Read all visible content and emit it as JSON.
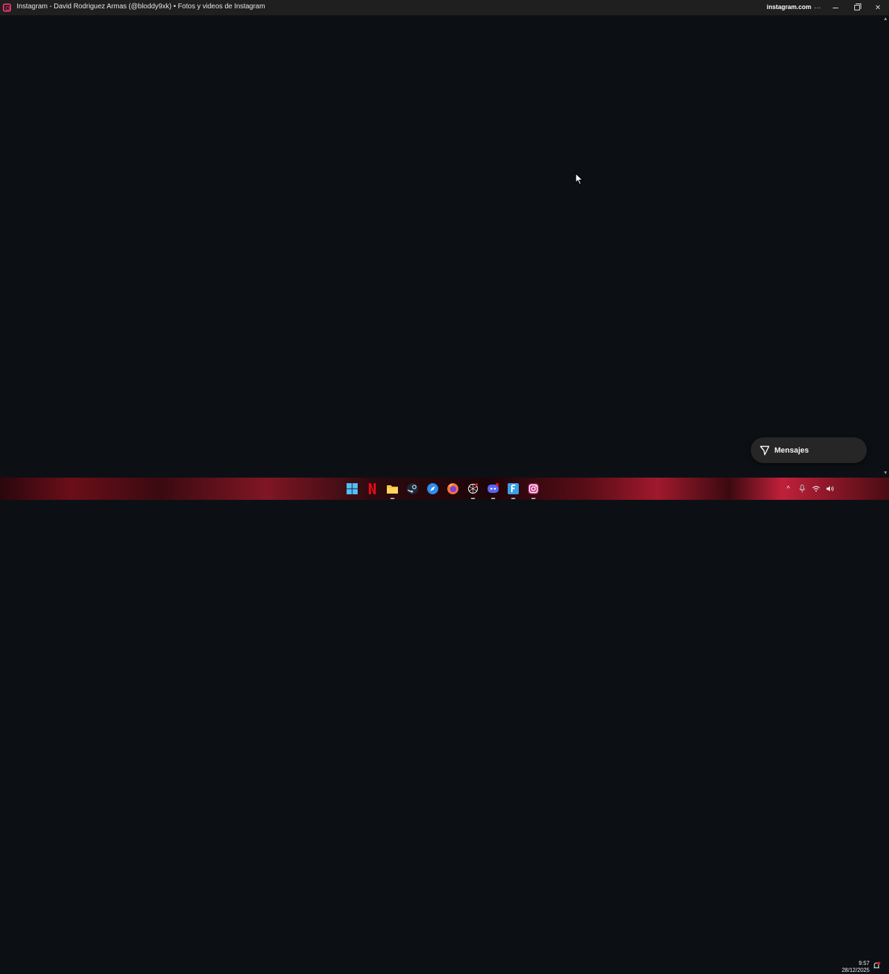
{
  "window": {
    "title": "Instagram - David Rodriguez Armas (@bloddy9xk) • Fotos y videos de Instagram",
    "domain": "instagram.com",
    "more_label": "···",
    "close_label": "✕"
  },
  "messages_button": {
    "label": "Mensajes"
  },
  "taskbar": {
    "apps": [
      "windows-start",
      "netflix",
      "file-explorer",
      "steam",
      "browser-blue",
      "firefox",
      "openai",
      "discord",
      "app-f",
      "instagram"
    ],
    "tray_chevron": "^",
    "time": "9:57",
    "date": "28/12/2025"
  },
  "colors": {
    "background": "#0c1014",
    "titlebar": "#1f1f1f",
    "pill": "#262626",
    "instagram_accent": "#e1306c"
  }
}
